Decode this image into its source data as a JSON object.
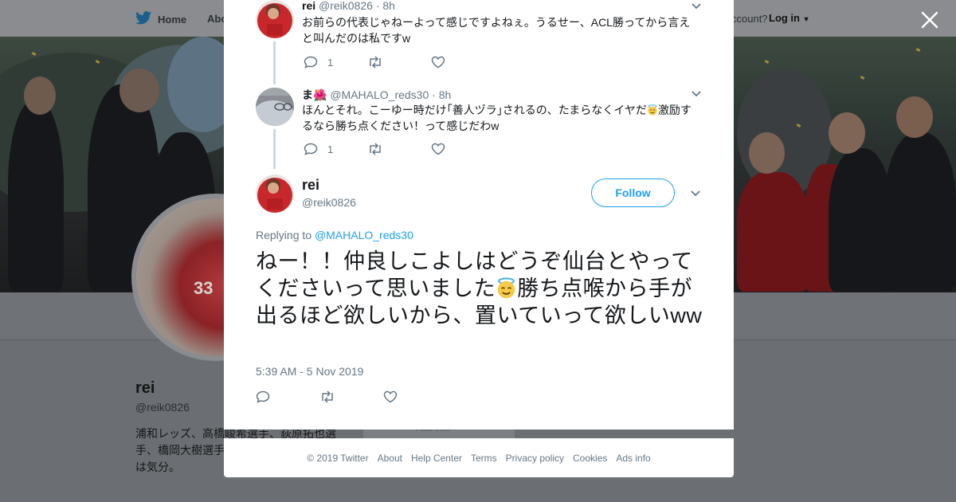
{
  "nav": {
    "home": "Home",
    "about": "Abo",
    "account_prompt": "ccount?",
    "login": "Log in"
  },
  "background_profile": {
    "name": "rei",
    "handle": "@reik0826",
    "bio": "浦和レッズ、高橋峻希選手、荻原拓也選手、橋岡大樹選手 ラクラスタ。他サ ロバは気分。",
    "card_text": "Ads info"
  },
  "modal": {
    "replies": [
      {
        "name": "rei",
        "handle": "@reik0826",
        "time": "· 8h",
        "text": "お前らの代表じゃねーよって感じですよねぇ。うるせー、ACL勝ってから言えと叫んだのは私ですw",
        "reply_count": "1"
      },
      {
        "name": "ま🌺",
        "handle": "@MAHALO_reds30",
        "time": "· 8h",
        "text_before": "ほんとそれ。こーゆー時だけ｢善人ヅラ｣されるの、たまらなくイヤだ",
        "text_after": "激励するなら勝ち点ください！って感じだわw",
        "reply_count": "1"
      }
    ],
    "main": {
      "name": "rei",
      "handle": "@reik0826",
      "follow_label": "Follow",
      "replying_prefix": "Replying to",
      "replying_handle": "@MAHALO_reds30",
      "text_before": "ねー！！仲良しこよしはどうぞ仙台とやってくださいって思いました",
      "text_after": "勝ち点喉から手が出るほど欲しいから、置いていって欲しいww",
      "timestamp": "5:39 AM - 5 Nov 2019"
    }
  },
  "footer": {
    "links": [
      "© 2019 Twitter",
      "About",
      "Help Center",
      "Terms",
      "Privacy policy",
      "Cookies",
      "Ads info"
    ]
  },
  "colors": {
    "accent": "#1da1f2",
    "muted": "#657786",
    "thread_line": "#c6d8e8",
    "overlay": "#6b6f73"
  }
}
